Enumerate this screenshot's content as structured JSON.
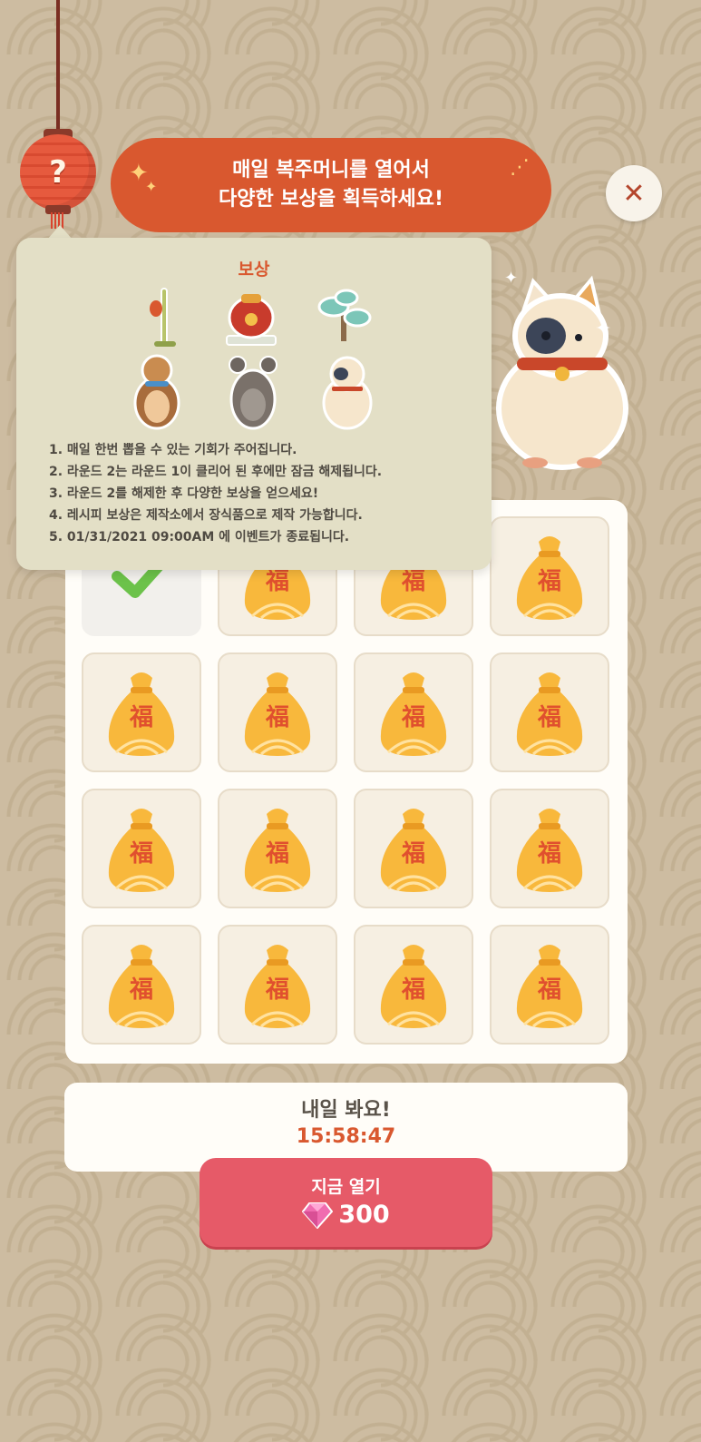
{
  "lantern": {
    "icon": "question-mark-icon",
    "symbol": "?"
  },
  "banner": {
    "line1": "매일 복주머니를 열어서",
    "line2": "다양한 보상을 획득하세요!"
  },
  "close_button": {
    "icon": "close-icon",
    "symbol": "✕"
  },
  "tooltip": {
    "title": "보상",
    "rewards": [
      "bamboo-lamp-icon",
      "red-pot-icon",
      "pine-bonsai-icon",
      "bear-character-icon",
      "mouse-character-icon",
      "cat-character-icon"
    ],
    "rules": [
      "1. 매일 한번 뽑을 수 있는 기회가 주어집니다.",
      "2. 라운드 2는 라운드 1이 클리어 된 후에만 잠금 해제됩니다.",
      "3. 라운드 2를 해제한 후 다양한 보상을 얻으세요!",
      "4. 레시피 보상은 제작소에서 장식품으로 제작 가능합니다.",
      "5. 01/31/2021 09:00AM 에 이벤트가 종료됩니다."
    ]
  },
  "grid": {
    "bag_char": "福",
    "cells": [
      "opened",
      "closed",
      "closed",
      "closed",
      "closed",
      "closed",
      "closed",
      "closed",
      "closed",
      "closed",
      "closed",
      "closed",
      "closed",
      "closed",
      "closed",
      "closed"
    ]
  },
  "timer": {
    "label": "내일 봐요!",
    "value": "15:58:47"
  },
  "open_now": {
    "label": "지금 열기",
    "price": "300",
    "currency_icon": "gem-icon"
  },
  "colors": {
    "accent": "#d9582f",
    "button": "#e65a68",
    "bag": "#f8b83c"
  }
}
